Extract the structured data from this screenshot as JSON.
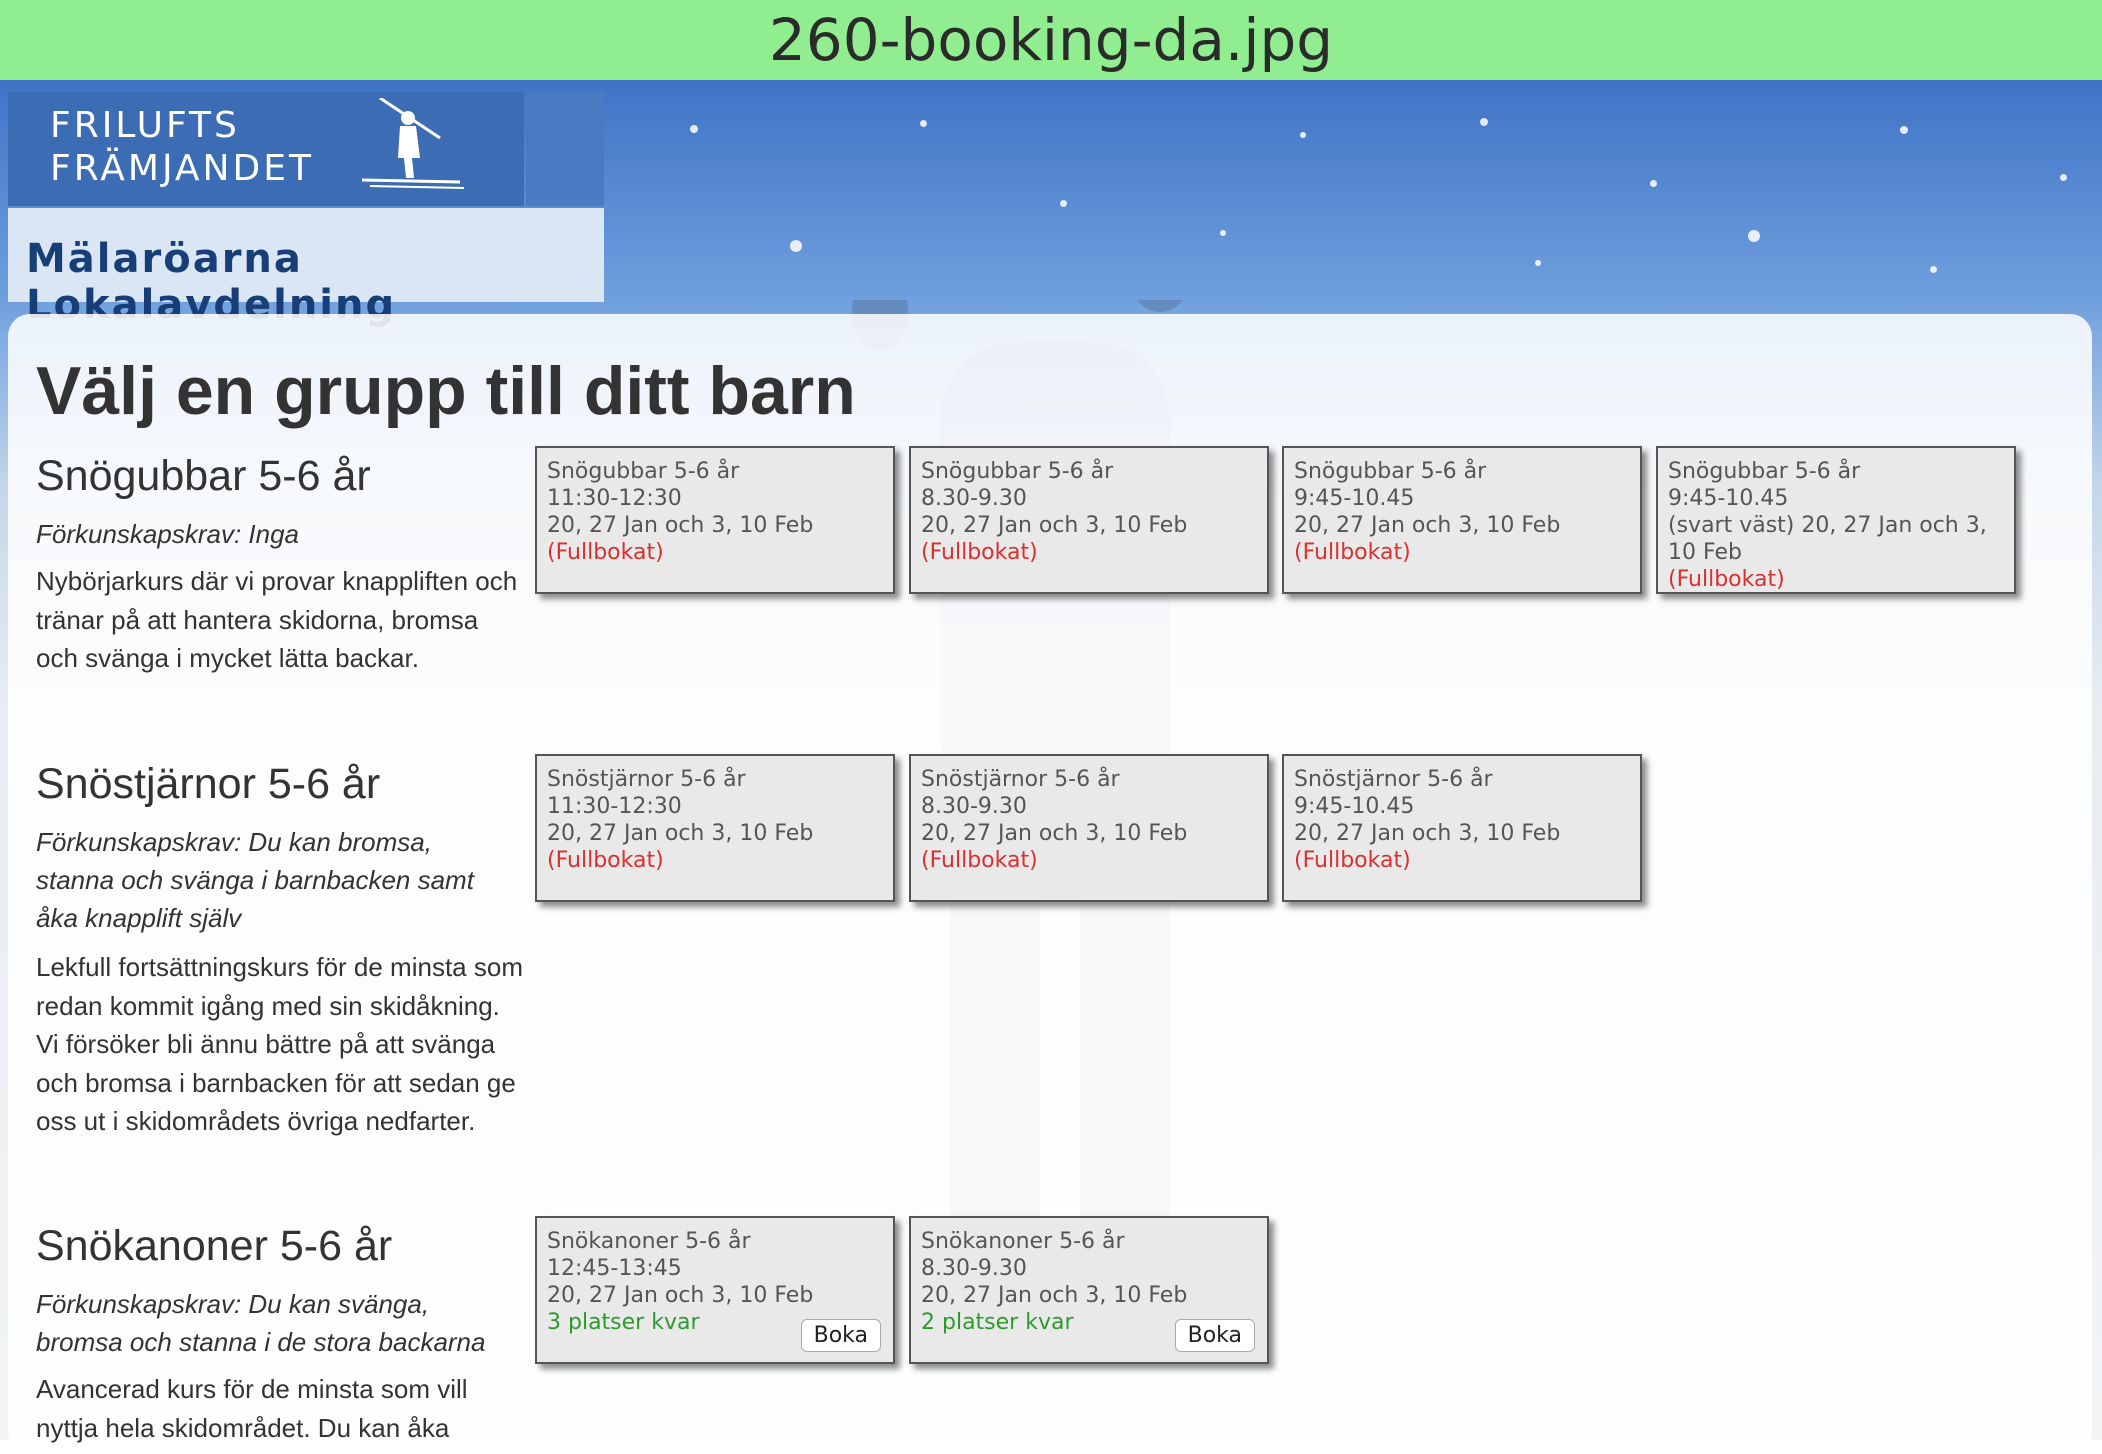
{
  "file_title": "260-booking-da.jpg",
  "logo": {
    "line1": "FRILUFTS",
    "line2": "FRÄMJANDET",
    "subtitle": "Mälaröarna Lokalavdelning"
  },
  "heading": "Välj en grupp till ditt barn",
  "groups": [
    {
      "title": "Snögubbar 5-6 år",
      "prereq": "Förkunskapskrav: Inga",
      "description": "Nybörjarkurs där vi provar knappliften och tränar på att hantera skidorna, bromsa och svänga i mycket lätta backar.",
      "sessions": [
        {
          "name": "Snögubbar 5-6 år",
          "time": "11:30-12:30",
          "dates": "20, 27 Jan och 3, 10 Feb",
          "status": "(Fullbokat)",
          "state": "full"
        },
        {
          "name": "Snögubbar 5-6 år",
          "time": "8.30-9.30",
          "dates": "20, 27 Jan och 3, 10 Feb",
          "status": "(Fullbokat)",
          "state": "full"
        },
        {
          "name": "Snögubbar 5-6 år",
          "time": "9:45-10.45",
          "dates": "20, 27 Jan och 3, 10 Feb",
          "status": "(Fullbokat)",
          "state": "full"
        },
        {
          "name": "Snögubbar 5-6 år",
          "time": "9:45-10.45",
          "dates": "(svart väst) 20, 27 Jan och 3, 10 Feb",
          "status": "(Fullbokat)",
          "state": "full"
        }
      ]
    },
    {
      "title": "Snöstjärnor 5-6 år",
      "prereq": "Förkunskapskrav: Du kan bromsa, stanna och svänga i barnbacken samt åka knapplift själv",
      "description": "Lekfull fortsättningskurs för de minsta som redan kommit igång med sin skidåkning. Vi försöker bli ännu bättre på att svänga och bromsa i barnbacken för att sedan ge oss ut i skidområdets övriga nedfarter.",
      "sessions": [
        {
          "name": "Snöstjärnor 5-6 år",
          "time": "11:30-12:30",
          "dates": "20, 27 Jan och 3, 10 Feb",
          "status": "(Fullbokat)",
          "state": "full"
        },
        {
          "name": "Snöstjärnor 5-6 år",
          "time": "8.30-9.30",
          "dates": "20, 27 Jan och 3, 10 Feb",
          "status": "(Fullbokat)",
          "state": "full"
        },
        {
          "name": "Snöstjärnor 5-6 år",
          "time": "9:45-10.45",
          "dates": "20, 27 Jan och 3, 10 Feb",
          "status": "(Fullbokat)",
          "state": "full"
        }
      ]
    },
    {
      "title": "Snökanoner 5-6 år",
      "prereq": "Förkunskapskrav: Du kan svänga, bromsa och stanna i de stora backarna",
      "description": "Avancerad kurs för de minsta som vill nyttja hela skidområdet. Du kan åka",
      "sessions": [
        {
          "name": "Snökanoner 5-6 år",
          "time": "12:45-13:45",
          "dates": "20, 27 Jan och 3, 10 Feb",
          "status": "3 platser kvar",
          "state": "available",
          "button": "Boka"
        },
        {
          "name": "Snökanoner 5-6 år",
          "time": "8.30-9.30",
          "dates": "20, 27 Jan och 3, 10 Feb",
          "status": "2 platser kvar",
          "state": "available",
          "button": "Boka"
        }
      ]
    }
  ]
}
